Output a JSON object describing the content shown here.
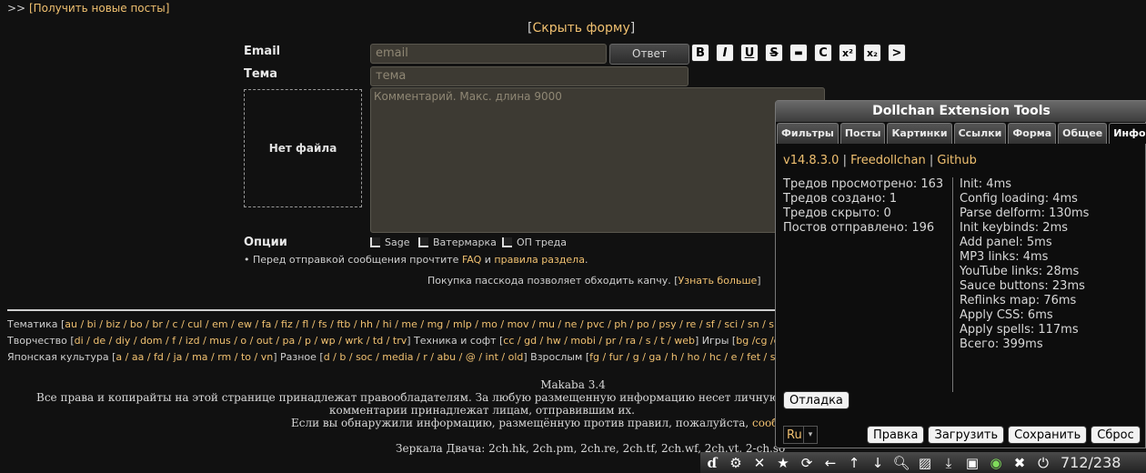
{
  "top": {
    "prefix": ">> ",
    "link": "[Получить новые посты]"
  },
  "form": {
    "hide_open": "[",
    "hide_link": "Скрыть форму",
    "hide_close": "]",
    "email_label": "Email",
    "email_placeholder": "email",
    "reply_button": "Ответ",
    "subject_label": "Тема",
    "subject_placeholder": "тема",
    "format_buttons": [
      "B",
      "I",
      "U",
      "S",
      "▬",
      "C",
      "x²",
      "x₂",
      ">"
    ],
    "file_box": "Нет файла",
    "comment_placeholder": "Комментарий. Макс. длина 9000",
    "options_label": "Опции",
    "options": [
      "Sage",
      "Ватермарка",
      "ОП треда"
    ],
    "rules_prefix": "• Перед отправкой сообщения прочтите ",
    "rules_faq": "FAQ",
    "rules_and": " и ",
    "rules_link": "правила раздела",
    "rules_end": ".",
    "passcode_text": "Покупка пасскода позволяет обходить капчу. [",
    "passcode_link": "Узнать больше",
    "passcode_end": "]"
  },
  "boards": {
    "line1_label": "Тематика [",
    "line1": "au / bi / biz / bo / br / c / cul / em / ew / fa / fiz / fl / fs / ftb / hh / hi / me / mg / mlp / mo / mov / mu / ne / pvc / ph / po / psy / re / sf / sci / sn / sp / spc / t",
    "line2_label": "Творчество [",
    "line2": "di / de / diy / dom / f / izd / mus / o / out / pa / p / wp / wrk / td / trv",
    "line2_mid": "]  Техника и софт [",
    "line2b": "cc / gd / hw / mobi / pr / ra / s / t / web",
    "line2_mid2": "]  Игры [",
    "line2c": "bg /cg /gb / mc /",
    "line3_label": "Японская культура [",
    "line3": "a / aa / fd / ja / ma / rm / to / vn",
    "line3_mid": "]  Разное [",
    "line3b": "d / b / soc / media / r / abu / @ / int / old",
    "line3_mid2": "]  Взрослым [",
    "line3c": "fg / fur / g / ga / h / ho / hc / e / fet / sex / fag",
    "line3_end": "]"
  },
  "footer": {
    "engine": "Makaba 3.4",
    "copyright1": "Все права и копирайты на этой странице принадлежат правообладателям. За любую размещенную информацию несет личную ответ",
    "copyright2": "комментарии принадлежат лицам, отправившим их.",
    "report_prefix": "Если вы обнаружили информацию, размещённую против правил, пожалуйста, ",
    "report_link": "сообщит",
    "mirrors": "Зеркала Двача: 2ch.hk, 2ch.pm, 2ch.re, 2ch.tf, 2ch.wf, 2ch.yt, 2-ch.so"
  },
  "panel": {
    "title": "Dollchan Extension Tools",
    "tabs": [
      "Фильтры",
      "Посты",
      "Картинки",
      "Ссылки",
      "Форма",
      "Общее",
      "Инфо"
    ],
    "active_tab": "Инфо",
    "version": "v14.8.3.0",
    "sep": " | ",
    "link1": "Freedollchan",
    "link2": "Github",
    "stats": [
      "Тредов просмотрено: 163",
      "Тредов создано: 1",
      "Тредов скрыто: 0",
      "Постов отправлено: 196"
    ],
    "timings": [
      "Init: 4ms",
      "Config loading: 4ms",
      "Parse delform: 130ms",
      "Init keybinds: 2ms",
      "Add panel: 5ms",
      "MP3 links: 4ms",
      "YouTube links: 28ms",
      "Sauce buttons: 23ms",
      "Reflinks map: 76ms",
      "Apply CSS: 6ms",
      "Apply spells: 117ms",
      "Всего: 399ms"
    ],
    "debug_button": "Отладка",
    "lang": "Ru",
    "buttons": [
      "Правка",
      "Загрузить",
      "Сохранить",
      "Сброс"
    ]
  },
  "toolbar": {
    "icons": [
      "de-logo-icon",
      "gear-icon",
      "close-icon",
      "star-icon",
      "refresh-icon",
      "arrow-left-icon",
      "arrow-up-icon",
      "arrow-down-icon",
      "magnifier-icon",
      "image-icon",
      "download-icon",
      "save-icon",
      "eye-icon",
      "mute-icon",
      "power-icon"
    ],
    "counter": "712/238"
  }
}
